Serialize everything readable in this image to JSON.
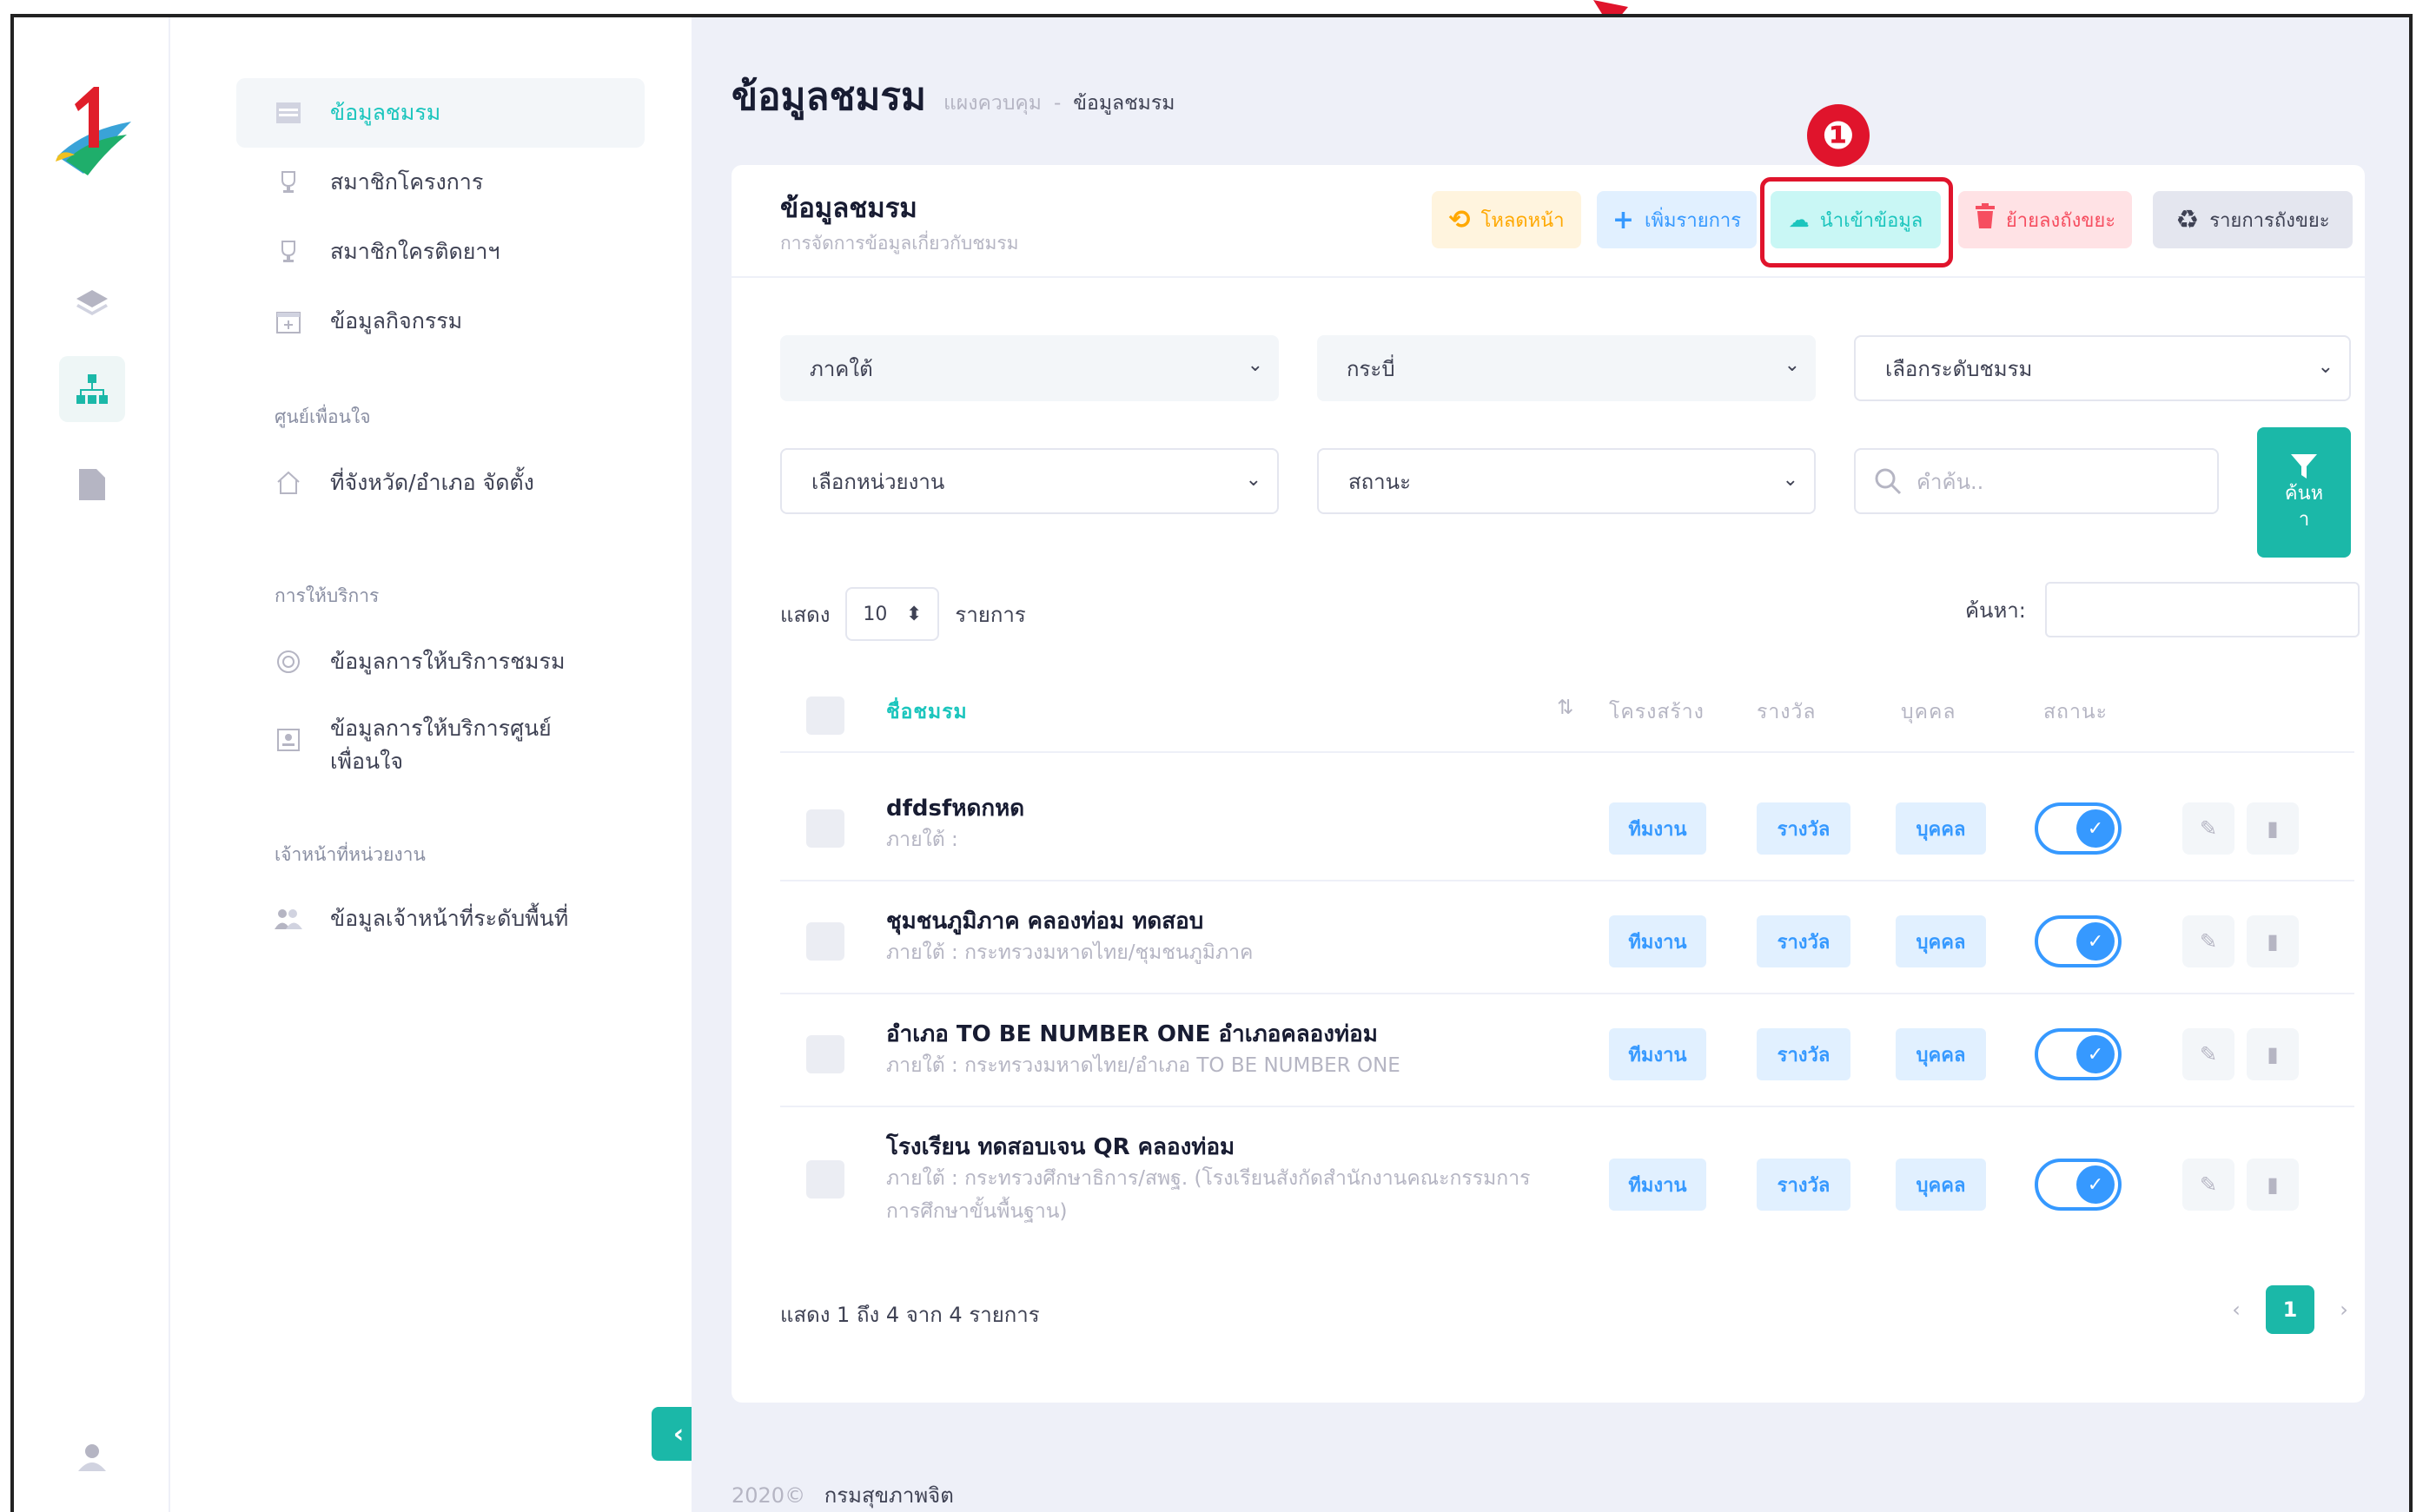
{
  "sidebar": {
    "items": [
      {
        "label": "ข้อมูลชมรม",
        "icon": "table-icon"
      },
      {
        "label": "สมาชิกโครงการ",
        "icon": "trophy-icon"
      },
      {
        "label": "สมาชิกใครติดยาฯ",
        "icon": "trophy-icon"
      },
      {
        "label": "ข้อมูลกิจกรรม",
        "icon": "calendar-icon"
      }
    ],
    "section_center": "ศูนย์เพื่อนใจ",
    "center_item": "ที่จังหวัด/อำเภอ จัดตั้ง",
    "section_service": "การให้บริการ",
    "service_items": [
      "ข้อมูลการให้บริการชมรม",
      "ข้อมูลการให้บริการศูนย์\nเพื่อนใจ"
    ],
    "section_staff": "เจ้าหน้าที่หน่วยงาน",
    "staff_item": "ข้อมูลเจ้าหน้าที่ระดับพื้นที่",
    "collapse_glyph": "‹"
  },
  "header": {
    "title": "ข้อมูลชมรม",
    "crumb_home": "แผงควบคุม",
    "crumb_sep": "-",
    "crumb_current": "ข้อมูลชมรม"
  },
  "card": {
    "title": "ข้อมูลชมรม",
    "subtitle": "การจัดการข้อมูลเกี่ยวกับชมรม",
    "buttons": {
      "reload": "โหลดหน้า",
      "add": "เพิ่มรายการ",
      "import": "นำเข้าข้อมูล",
      "trash": "ย้ายลงถังขยะ",
      "trash_list": "รายการถังขยะ"
    }
  },
  "filters": {
    "region": "ภาคใต้",
    "province": "กระบี่",
    "level": "เลือกระดับชมรม",
    "unit": "เลือกหน่วยงาน",
    "status": "สถานะ",
    "search_placeholder": "คำค้น..",
    "search_button": "ค้นห\nา"
  },
  "table_controls": {
    "show_label": "แสดง",
    "page_length": "10",
    "records_label": "รายการ",
    "find_label": "ค้นหา:"
  },
  "table": {
    "headers": [
      "ชื่อชมรม",
      "โครงสร้าง",
      "รางวัล",
      "บุคคล",
      "สถานะ"
    ],
    "sort_glyph": "⇅",
    "rows": [
      {
        "name": "dfdsfหดกหด",
        "sub": "ภายใต้ :",
        "structure": "ทีมงาน",
        "award": "รางวัล",
        "person": "บุคคล",
        "status": true
      },
      {
        "name": "ชุมชนภูมิภาค คลองท่อม ทดสอบ",
        "sub": "ภายใต้ : กระทรวงมหาดไทย/ชุมชนภูมิภาค",
        "structure": "ทีมงาน",
        "award": "รางวัล",
        "person": "บุคคล",
        "status": true
      },
      {
        "name": "อำเภอ TO BE NUMBER ONE อำเภอคลองท่อม",
        "sub": "ภายใต้ : กระทรวงมหาดไทย/อำเภอ TO BE NUMBER ONE",
        "structure": "ทีมงาน",
        "award": "รางวัล",
        "person": "บุคคล",
        "status": true
      },
      {
        "name": "โรงเรียน ทดสอบเจน QR คลองท่อม",
        "sub": "ภายใต้ : กระทรวงศึกษาธิการ/สพฐ. (โรงเรียนสังกัดสำนักงานคณะกรรมการการศึกษาขั้นพื้นฐาน)",
        "structure": "ทีมงาน",
        "award": "รางวัล",
        "person": "บุคคล",
        "status": true
      }
    ]
  },
  "pagination": {
    "info": "แสดง 1 ถึง 4 จาก 4 รายการ",
    "prev": "‹",
    "current": "1",
    "next": "›"
  },
  "footer": {
    "year": "2020©",
    "org": "กรมสุขภาพจิต"
  },
  "annotation": {
    "marker": "❶"
  },
  "colors": {
    "accent": "#1bb8a8",
    "primary": "#3699ff",
    "warning": "#ffa800",
    "danger": "#f64e60",
    "highlight": "#e0142c"
  }
}
